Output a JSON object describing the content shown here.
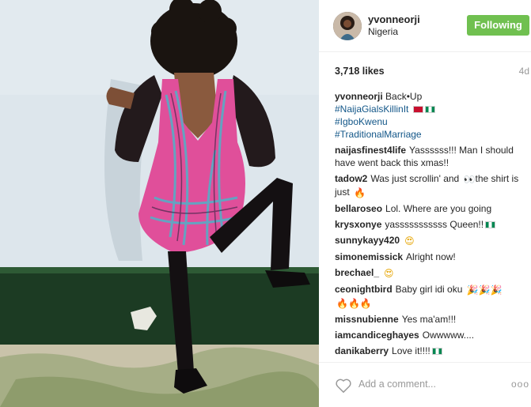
{
  "post": {
    "username": "yvonneorji",
    "location": "Nigeria",
    "follow_label": "Following",
    "likes": "3,718 likes",
    "age": "4d"
  },
  "caption": {
    "username": "yvonneorji",
    "text": "Back•Up",
    "hashtags": [
      "#NaijaGialsKillinIt",
      "#IgboKwenu",
      "#TraditionalMarriage"
    ]
  },
  "comments": [
    {
      "user": "naijasfinest4life",
      "text": "Yassssss!!! Man I should have went back this xmas!!"
    },
    {
      "user": "tadow2",
      "text": "Was just scrollin' and",
      "text2": "the shirt is just"
    },
    {
      "user": "bellaroseo",
      "text": "Lol. Where are you going"
    },
    {
      "user": "krysxonye",
      "text": "yasssssssssss Queen!!"
    },
    {
      "user": "sunnykayy420",
      "text": ""
    },
    {
      "user": "simonemissick",
      "text": "Alright now!"
    },
    {
      "user": "brechael_",
      "text": ""
    },
    {
      "user": "ceonightbird",
      "text": "Baby girl idi oku"
    },
    {
      "user": "missnubienne",
      "text": "Yes ma'am!!!"
    },
    {
      "user": "iamcandiceghayes",
      "text": "Owwwww...."
    },
    {
      "user": "danikaberry",
      "text": "Love it!!!!"
    }
  ],
  "footer": {
    "add_comment_placeholder": "Add a comment...",
    "more_label": "ooo"
  },
  "icons": {
    "like": "heart-outline-icon",
    "more": "more-options-icon"
  },
  "colors": {
    "follow_button": "#70c050",
    "hashtag": "#125688"
  }
}
